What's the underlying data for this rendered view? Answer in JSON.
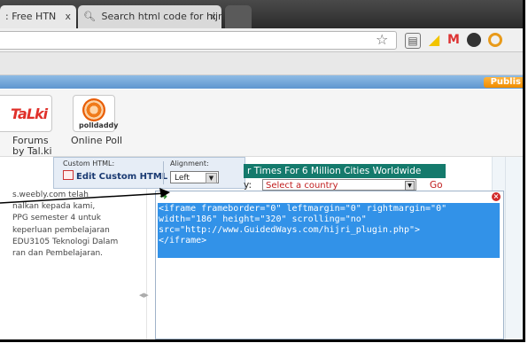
{
  "browser": {
    "tabs": [
      {
        "title": ": Free HTN",
        "close": "x"
      },
      {
        "title": "Search html code for hijri",
        "close": "x",
        "icon": "search-icon"
      },
      {
        "title": ""
      }
    ],
    "omnibox_value": "",
    "extensions": [
      "star-icon",
      "screenshot-icon",
      "pacman-icon",
      "gmail-icon",
      "circle-icon",
      "orange-icon"
    ]
  },
  "toolbar": {
    "publish_label": "Publis"
  },
  "elements": {
    "talki": {
      "logo": "TaLki",
      "label_line1": "Forums",
      "label_line2": "by Tal.ki"
    },
    "poll": {
      "logo": "polldaddy",
      "label": "Online Poll"
    }
  },
  "custom_html_toolbar": {
    "title": "Custom HTML:",
    "edit_label": "Edit Custom HTML",
    "alignment_title": "Alignment:",
    "alignment_value": "Left"
  },
  "prayer_widget": {
    "header": "r Times For 6 Million Cities Worldwide",
    "country_label": "y:",
    "select_placeholder": "Select a country",
    "go_label": "Go"
  },
  "page_text": {
    "lines": [
      "s.weebly.com telah",
      "nalkan kepada kami,",
      "PPG semester 4 untuk",
      " keperluan pembelajaran",
      "EDU3105 Teknologi Dalam",
      "ran dan Pembelajaran."
    ]
  },
  "code_editor": {
    "lines": [
      "<iframe frameborder=\"0\" leftmargin=\"0\" rightmargin=\"0\"",
      "width=\"186\" height=\"320\" scrolling=\"no\"",
      "src=\"http://www.GuidedWays.com/hijri_plugin.php\">",
      "</iframe>"
    ]
  },
  "colors": {
    "widget_header": "#147a6c",
    "selection": "#3292e8",
    "publish": "#f08c00",
    "toolbar_blue": "#6ea5d9"
  }
}
